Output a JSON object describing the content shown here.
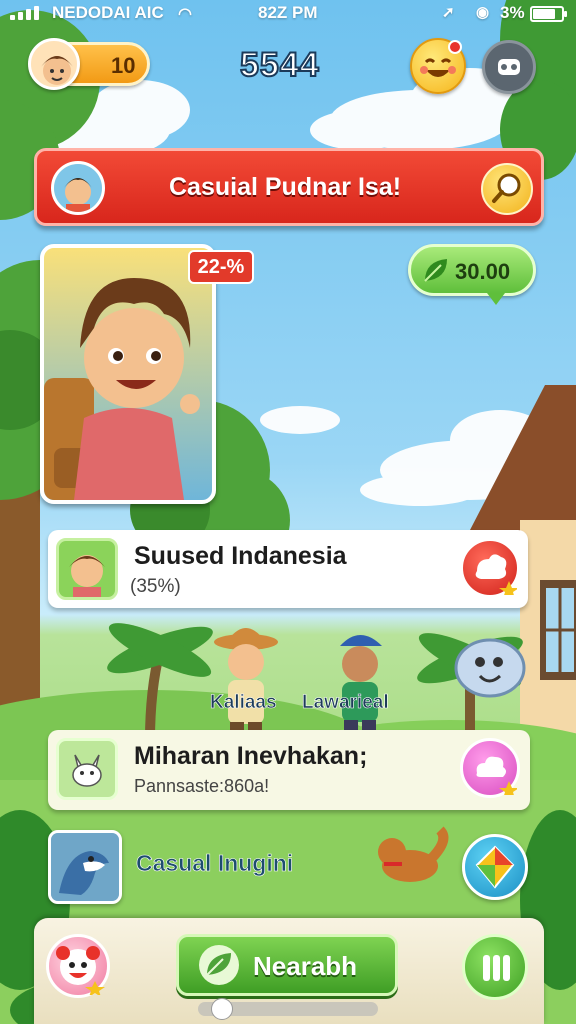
{
  "status_bar": {
    "carrier": "NEDODAI AIC",
    "time": "82Z PM",
    "battery": "3%",
    "battery_fill_fraction": 0.8
  },
  "hud": {
    "coins": "10",
    "score": "5544",
    "icons": {
      "smiley": "smiley-face-icon",
      "menu": "game-controller-icon"
    }
  },
  "banner": {
    "title": "Casuial Pudnar Isa!",
    "icon": "magnifier-icon"
  },
  "portrait": {
    "discount": "22-%",
    "price": "30.00",
    "price_icon": "leaf-icon"
  },
  "cards": [
    {
      "title": "Suused Indanesia",
      "subtitle": "(35%)",
      "action_icon": "red-splash-icon",
      "colors": {
        "action": "#e53a2f"
      }
    },
    {
      "title": "Miharan Inevhakan;",
      "subtitle": "Pannsaste:860a!",
      "action_icon": "pink-cloud-icon",
      "colors": {
        "action": "#f07ad8"
      }
    }
  ],
  "characters": {
    "left_label": "Kaliaas",
    "right_label": "Lawarieal"
  },
  "row3": {
    "label": "Casual Inugini",
    "button_icon": "kite-icon"
  },
  "bottom_bar": {
    "nearby_label": "Nearabh",
    "nearby_icon": "leaf-icon",
    "left_icon": "clown-icon",
    "right_icon": "pause-icon",
    "slider_fraction": 0.05
  }
}
